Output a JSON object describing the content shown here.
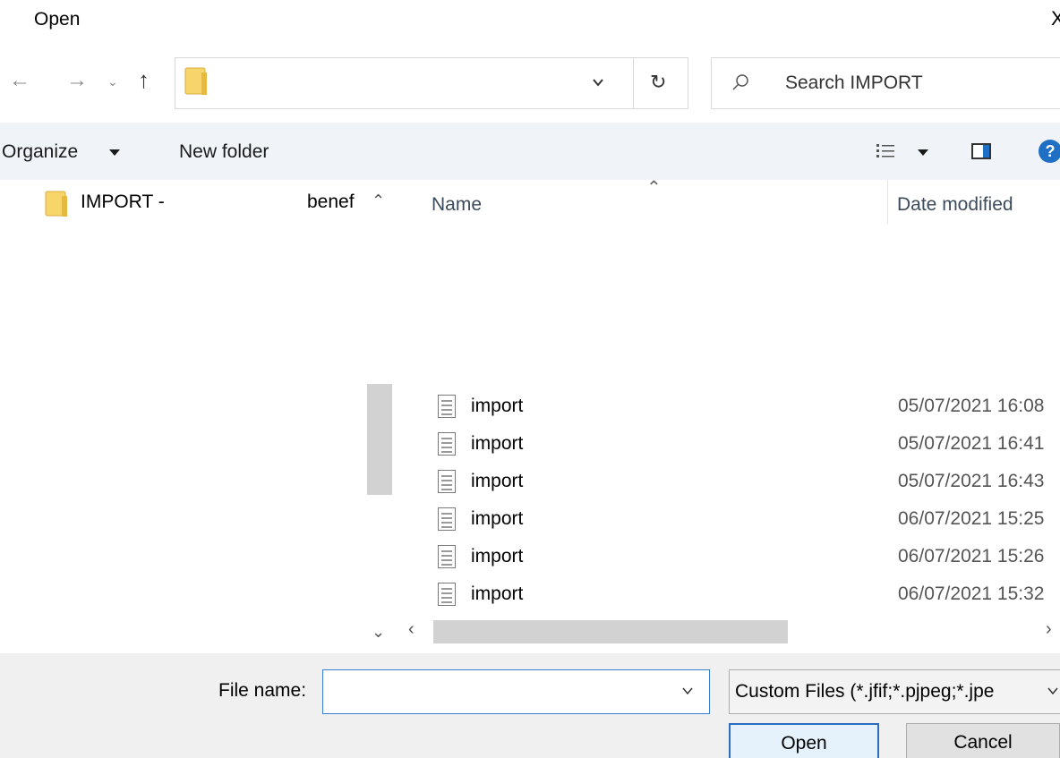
{
  "window": {
    "title": "Open",
    "close_glyph": "X"
  },
  "nav": {
    "back_icon": "arrow-left-icon",
    "forward_icon": "arrow-right-icon",
    "recent_icon": "chevron-down-icon",
    "up_icon": "arrow-up-icon",
    "address_value": "",
    "search_placeholder": "Search IMPORT"
  },
  "commandbar": {
    "organize_label": "Organize",
    "new_folder_label": "New folder",
    "help_glyph": "?"
  },
  "navpane": {
    "folder_label": "IMPORT -",
    "folder_label_tail": "benef"
  },
  "filelist": {
    "columns": {
      "name": "Name",
      "date": "Date modified"
    },
    "rows": [
      {
        "name": "import",
        "date": "05/07/2021 16:08"
      },
      {
        "name": "import",
        "date": "05/07/2021 16:41"
      },
      {
        "name": "import",
        "date": "05/07/2021 16:43"
      },
      {
        "name": "import",
        "date": "06/07/2021 15:25"
      },
      {
        "name": "import",
        "date": "06/07/2021 15:26"
      },
      {
        "name": "import",
        "date": "06/07/2021 15:32"
      }
    ]
  },
  "footer": {
    "file_name_label": "File name:",
    "file_name_value": "",
    "file_type_value": "Custom Files (*.jfif;*.pjpeg;*.jpe",
    "open_label": "Open",
    "cancel_label": "Cancel"
  },
  "colors": {
    "accent": "#2a6cc0",
    "commandbar_bg": "#f0f4f9",
    "footer_bg": "#f0f0f0"
  }
}
